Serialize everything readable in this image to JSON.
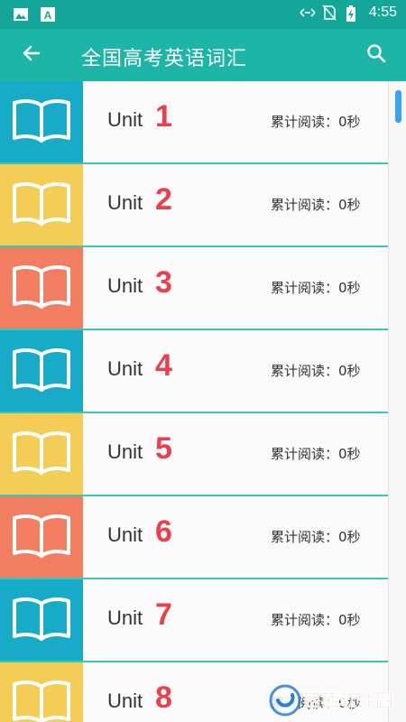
{
  "status_bar": {
    "time": "4:55",
    "left_icons": [
      "image-icon",
      "a-letter-icon"
    ],
    "right_icons": [
      "data-transfer-icon",
      "no-sim-icon",
      "battery-charging-icon"
    ]
  },
  "app_bar": {
    "title": "全国高考英语词汇",
    "back_icon": "arrow-left-icon",
    "search_icon": "search-icon"
  },
  "colors": {
    "status_bar": "#14a698",
    "app_bar": "#1cb5a6",
    "divider": "#3cc6b4",
    "unit_number": "#e8404c",
    "thumb_blue": "#17abc8",
    "thumb_yellow": "#f3cd55",
    "thumb_coral": "#f27e62",
    "scroll_thumb": "#3aa4f0"
  },
  "units": [
    {
      "label": "Unit",
      "number": "1",
      "stat": "累计阅读：0秒",
      "color": "#17abc8"
    },
    {
      "label": "Unit",
      "number": "2",
      "stat": "累计阅读：0秒",
      "color": "#f3cd55"
    },
    {
      "label": "Unit",
      "number": "3",
      "stat": "累计阅读：0秒",
      "color": "#f27e62"
    },
    {
      "label": "Unit",
      "number": "4",
      "stat": "累计阅读：0秒",
      "color": "#17abc8"
    },
    {
      "label": "Unit",
      "number": "5",
      "stat": "累计阅读：0秒",
      "color": "#f3cd55"
    },
    {
      "label": "Unit",
      "number": "6",
      "stat": "累计阅读：0秒",
      "color": "#f27e62"
    },
    {
      "label": "Unit",
      "number": "7",
      "stat": "累计阅读：0秒",
      "color": "#17abc8"
    },
    {
      "label": "Unit",
      "number": "8",
      "stat": "累计阅读：0秒",
      "color": "#f3cd55"
    }
  ],
  "watermark": {
    "text": "西西软件园",
    "icon": "watermark-logo-icon"
  }
}
